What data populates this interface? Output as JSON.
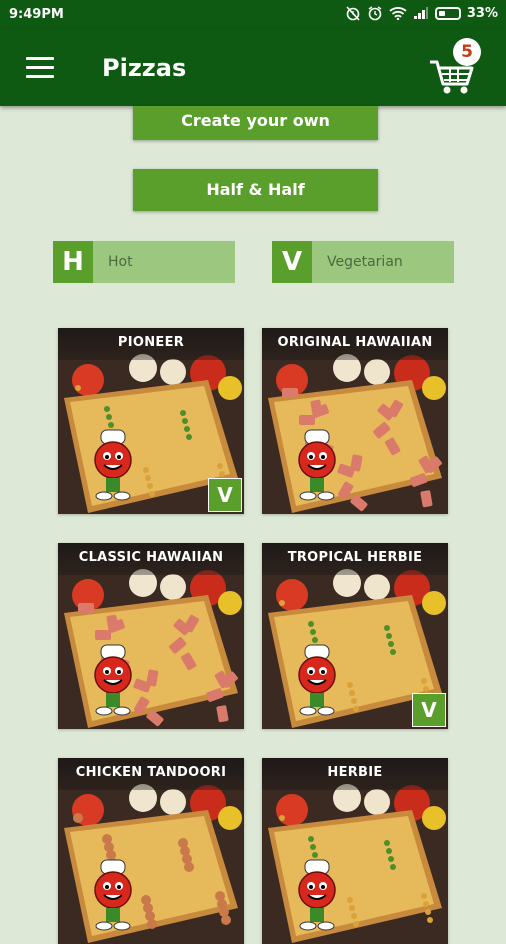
{
  "status_bar": {
    "time": "9:49PM",
    "battery_percent": "33%",
    "battery_level": 0.33,
    "icons": [
      "alarm-off-icon",
      "alarm-clock-icon",
      "wifi-icon",
      "signal-icon",
      "battery-icon"
    ]
  },
  "app_bar": {
    "title": "Pizzas",
    "cart_count": "5",
    "menu_icon": "hamburger-menu-icon",
    "cart_icon": "shopping-cart-icon"
  },
  "actions": {
    "create_own": "Create your own",
    "half_half": "Half & Half"
  },
  "filters": [
    {
      "letter": "H",
      "label": "Hot"
    },
    {
      "letter": "V",
      "label": "Vegetarian"
    }
  ],
  "pizzas": [
    {
      "name": "PIONEER",
      "vegetarian": "V"
    },
    {
      "name": "ORIGINAL HAWAIIAN"
    },
    {
      "name": "CLASSIC HAWAIIAN"
    },
    {
      "name": "TROPICAL HERBIE",
      "vegetarian": "V"
    },
    {
      "name": "CHICKEN TANDOORI"
    },
    {
      "name": "HERBIE"
    }
  ],
  "colors": {
    "primary": "#0f5a12",
    "accent": "#5a9f2c",
    "filter_bg": "#9cc77f",
    "background": "#dde9d6",
    "badge_text": "#c63a16"
  }
}
